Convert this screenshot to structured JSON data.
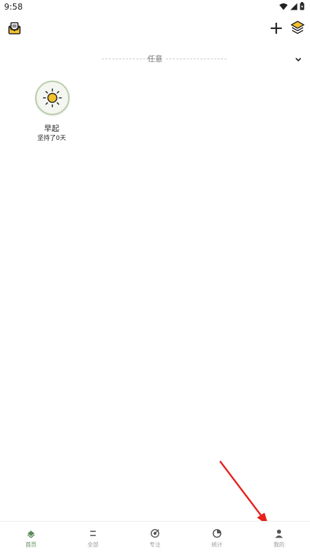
{
  "status_bar": {
    "time": "9:58"
  },
  "section": {
    "title": "任意"
  },
  "habits": [
    {
      "name": "早起",
      "streak": "坚持了0天",
      "icon": "sun-icon"
    }
  ],
  "bottom_nav": [
    {
      "label": "首页",
      "icon": "home-leaf-icon",
      "active": true
    },
    {
      "label": "全部",
      "icon": "list-icon",
      "active": false
    },
    {
      "label": "专注",
      "icon": "target-icon",
      "active": false
    },
    {
      "label": "统计",
      "icon": "pie-chart-icon",
      "active": false
    },
    {
      "label": "我的",
      "icon": "person-icon",
      "active": false
    }
  ],
  "colors": {
    "accent": "#5b8a5b",
    "mail_yellow": "#f2c12e",
    "habit_border": "#b7cea9",
    "annotation_arrow": "#e8211b"
  }
}
